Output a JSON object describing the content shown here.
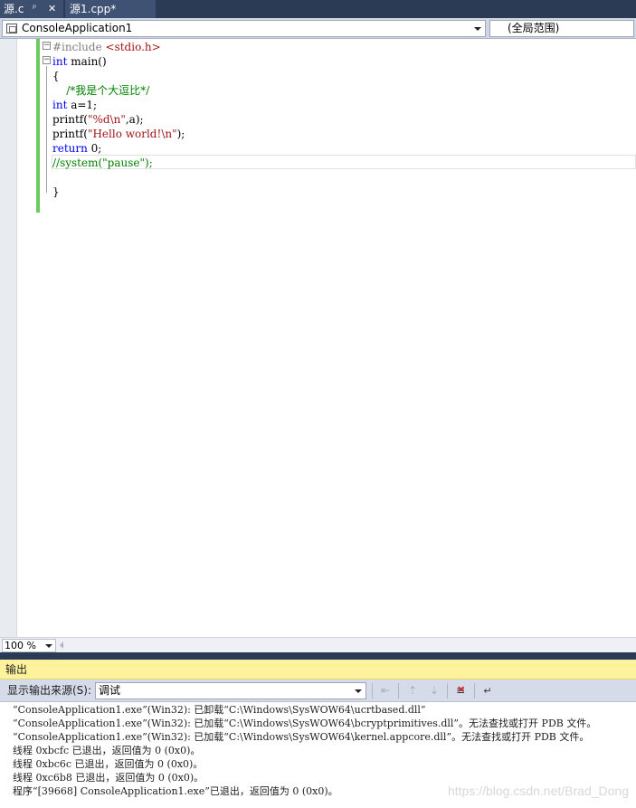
{
  "tabs": [
    {
      "label": "源.c",
      "pin": "ᵖ",
      "close": "✕"
    },
    {
      "label": "源1.cpp*"
    }
  ],
  "navbar": {
    "project_scope": "ConsoleApplication1",
    "member_scope": "(全局范围)"
  },
  "editor": {
    "lines": [
      {
        "parts": [
          {
            "t": "#include ",
            "c": "pp"
          },
          {
            "t": "<stdio.h>",
            "c": "str"
          }
        ]
      },
      {
        "parts": [
          {
            "t": "int",
            "c": "kw"
          },
          {
            "t": " main()",
            "c": ""
          }
        ]
      },
      {
        "parts": [
          {
            "t": "{",
            "c": ""
          }
        ]
      },
      {
        "parts": [
          {
            "t": "    /*我是个大逗比*/",
            "c": "cm"
          }
        ]
      },
      {
        "parts": [
          {
            "t": "int",
            "c": "kw"
          },
          {
            "t": " a=1;",
            "c": ""
          }
        ]
      },
      {
        "parts": [
          {
            "t": "printf(",
            "c": ""
          },
          {
            "t": "\"%d\\n\"",
            "c": "str"
          },
          {
            "t": ",a);",
            "c": ""
          }
        ]
      },
      {
        "parts": [
          {
            "t": "printf(",
            "c": ""
          },
          {
            "t": "\"Hello world!\\n\"",
            "c": "str"
          },
          {
            "t": ");",
            "c": ""
          }
        ]
      },
      {
        "parts": [
          {
            "t": "return",
            "c": "kw"
          },
          {
            "t": " 0;",
            "c": ""
          }
        ]
      },
      {
        "parts": [
          {
            "t": "//system(\"pause\");",
            "c": "cm"
          }
        ]
      },
      {
        "parts": [
          {
            "t": "",
            "c": ""
          }
        ]
      },
      {
        "parts": [
          {
            "t": "}",
            "c": ""
          }
        ]
      }
    ]
  },
  "zoom": {
    "value": "100 %"
  },
  "output": {
    "title": "输出",
    "source_label": "显示输出来源(S):",
    "source_value": "调试",
    "lines": [
      "“ConsoleApplication1.exe”(Win32): 已卸载“C:\\Windows\\SysWOW64\\ucrtbased.dll”",
      "“ConsoleApplication1.exe”(Win32): 已加载“C:\\Windows\\SysWOW64\\bcryptprimitives.dll”。无法查找或打开 PDB 文件。",
      "“ConsoleApplication1.exe”(Win32): 已加载“C:\\Windows\\SysWOW64\\kernel.appcore.dll”。无法查找或打开 PDB 文件。",
      "线程 0xbcfc 已退出，返回值为 0 (0x0)。",
      "线程 0xbc6c 已退出，返回值为 0 (0x0)。",
      "线程 0xc6b8 已退出，返回值为 0 (0x0)。",
      "程序“[39668] ConsoleApplication1.exe”已退出，返回值为 0 (0x0)。"
    ]
  },
  "watermark": "https://blog.csdn.net/Brad_Dong"
}
